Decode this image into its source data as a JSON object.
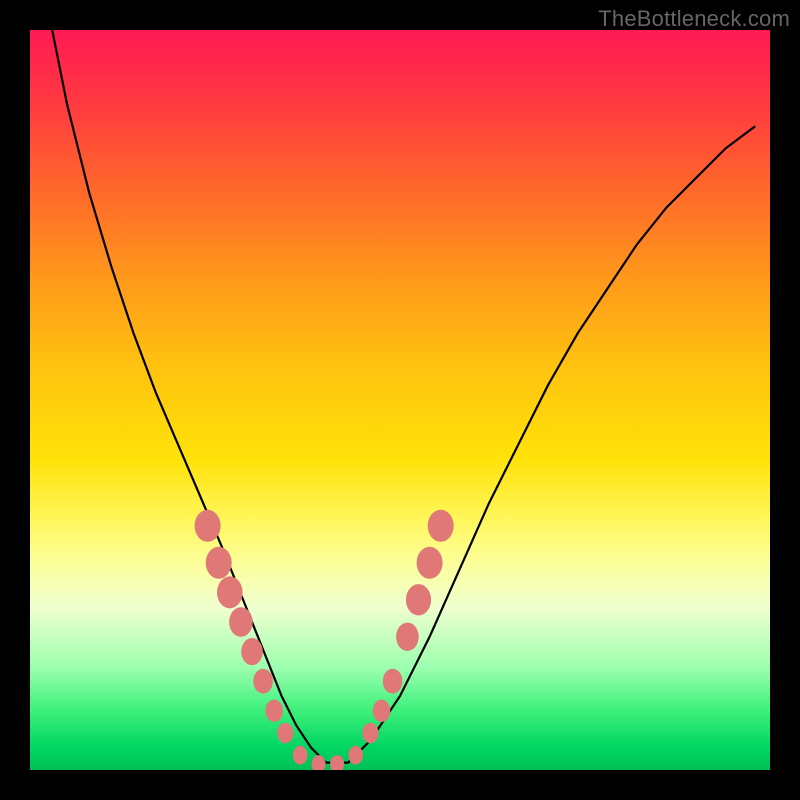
{
  "watermark": "TheBottleneck.com",
  "chart_data": {
    "type": "line",
    "title": "",
    "xlabel": "",
    "ylabel": "",
    "xlim": [
      0,
      100
    ],
    "ylim": [
      0,
      100
    ],
    "series": [
      {
        "name": "bottleneck-curve",
        "x": [
          3,
          5,
          8,
          11,
          14,
          17,
          20,
          23,
          26,
          28,
          30,
          32,
          34,
          36,
          38,
          40,
          43,
          46,
          50,
          54,
          58,
          62,
          66,
          70,
          74,
          78,
          82,
          86,
          90,
          94,
          98
        ],
        "y": [
          100,
          90,
          78,
          68,
          59,
          51,
          44,
          37,
          30,
          25,
          20,
          15,
          10,
          6,
          3,
          1,
          1,
          4,
          10,
          18,
          27,
          36,
          44,
          52,
          59,
          65,
          71,
          76,
          80,
          84,
          87
        ]
      }
    ],
    "markers": {
      "name": "highlight-points",
      "color": "#e07878",
      "points": [
        {
          "x": 24,
          "y": 33
        },
        {
          "x": 25.5,
          "y": 28
        },
        {
          "x": 27,
          "y": 24
        },
        {
          "x": 28.5,
          "y": 20
        },
        {
          "x": 30,
          "y": 16
        },
        {
          "x": 31.5,
          "y": 12
        },
        {
          "x": 33,
          "y": 8
        },
        {
          "x": 34.5,
          "y": 5
        },
        {
          "x": 36.5,
          "y": 2
        },
        {
          "x": 39,
          "y": 0.8
        },
        {
          "x": 41.5,
          "y": 0.8
        },
        {
          "x": 44,
          "y": 2
        },
        {
          "x": 46,
          "y": 5
        },
        {
          "x": 47.5,
          "y": 8
        },
        {
          "x": 49,
          "y": 12
        },
        {
          "x": 51,
          "y": 18
        },
        {
          "x": 52.5,
          "y": 23
        },
        {
          "x": 54,
          "y": 28
        },
        {
          "x": 55.5,
          "y": 33
        }
      ]
    },
    "background_gradient": {
      "top": "#ff1a55",
      "mid": "#ffe208",
      "bottom": "#00c056"
    }
  }
}
